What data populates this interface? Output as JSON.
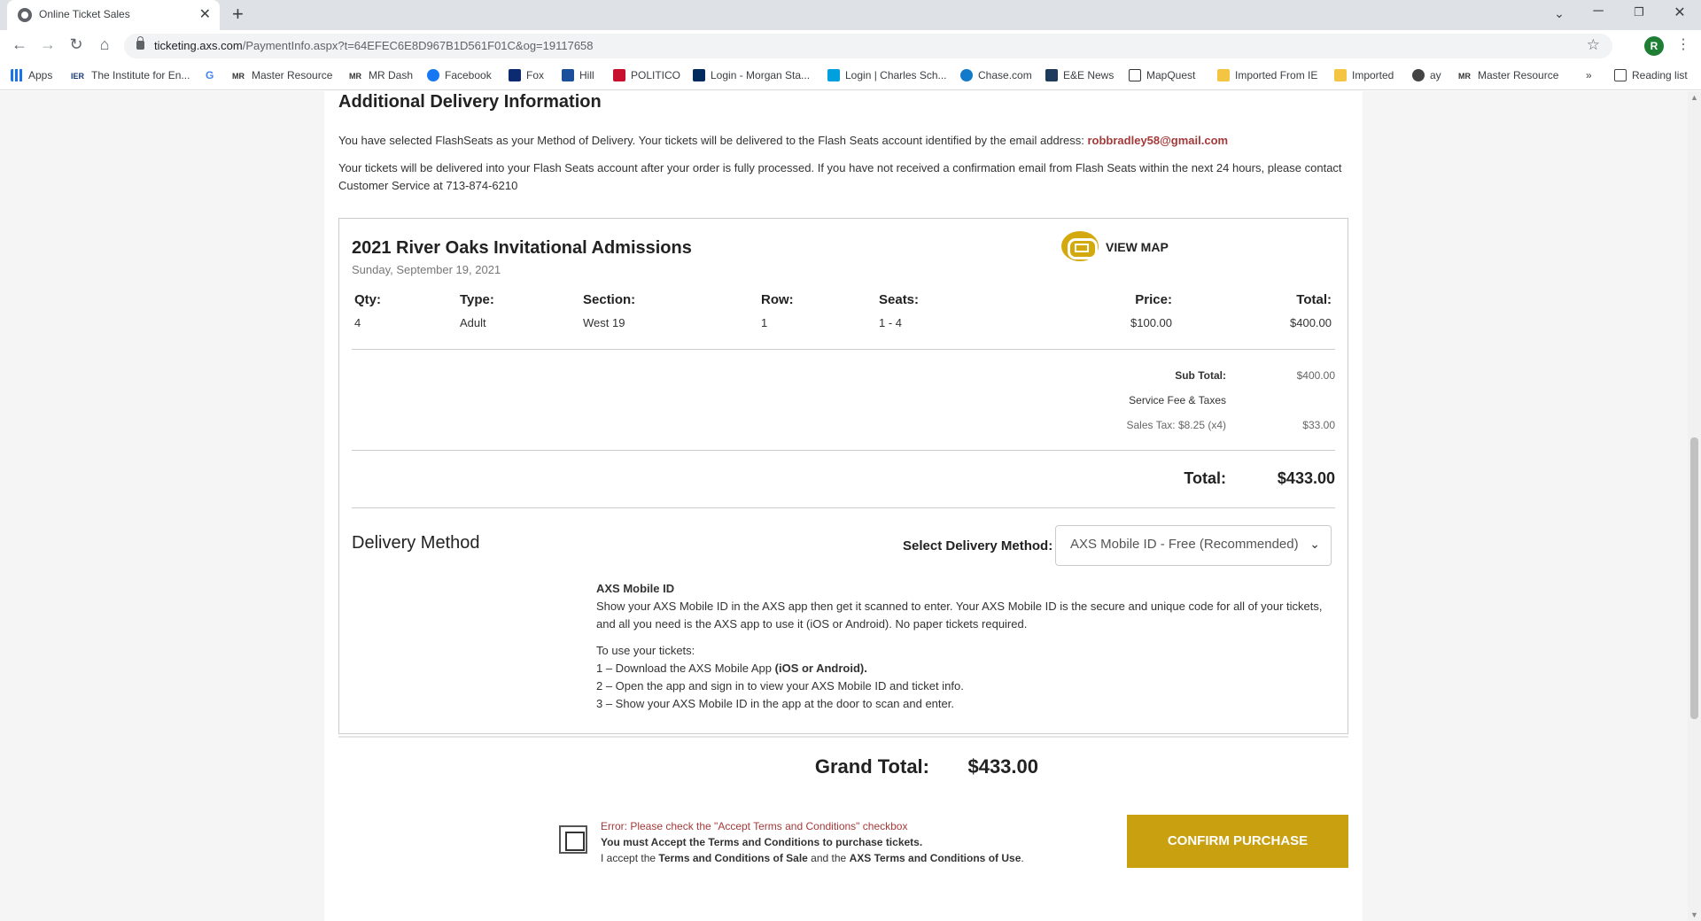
{
  "browser": {
    "tab_title": "Online Ticket Sales",
    "url_host": "ticketing.axs.com",
    "url_path": "/PaymentInfo.aspx?t=64EFEC6E8D967B1D561F01C&og=19117658",
    "profile_initial": "R",
    "bookmarks": [
      {
        "label": "Apps",
        "icon": "apps-grid-icon"
      },
      {
        "label": "The Institute for En...",
        "icon": "ier-icon",
        "icon_text": "IER"
      },
      {
        "label": "",
        "icon": "google-icon",
        "icon_text": "G"
      },
      {
        "label": "Master Resource",
        "icon": "mr-icon",
        "icon_text": "MR"
      },
      {
        "label": "MR Dash",
        "icon": "mr-icon",
        "icon_text": "MR"
      },
      {
        "label": "Facebook",
        "icon": "facebook-icon"
      },
      {
        "label": "Fox",
        "icon": "fox-icon"
      },
      {
        "label": "Hill",
        "icon": "hill-icon"
      },
      {
        "label": "POLITICO",
        "icon": "politico-icon"
      },
      {
        "label": "Login - Morgan Sta...",
        "icon": "morgan-stanley-icon"
      },
      {
        "label": "Login | Charles Sch...",
        "icon": "schwab-icon"
      },
      {
        "label": "Chase.com",
        "icon": "chase-icon"
      },
      {
        "label": "E&E News",
        "icon": "ee-news-icon"
      },
      {
        "label": "MapQuest",
        "icon": "mapquest-icon"
      },
      {
        "label": "Imported From IE",
        "icon": "folder-icon"
      },
      {
        "label": "Imported",
        "icon": "folder-icon"
      },
      {
        "label": "ay",
        "icon": "globe-icon"
      },
      {
        "label": "Master Resource",
        "icon": "mr-icon",
        "icon_text": "MR"
      }
    ],
    "overflow_label": "»",
    "reading_list": "Reading list"
  },
  "delivery_info": {
    "heading": "Additional Delivery Information",
    "line1_prefix": "You have selected FlashSeats as your Method of Delivery. Your tickets will be delivered to the Flash Seats account identified by the email address:",
    "email": "robbradley58@gmail.com",
    "line2": "Your tickets will be delivered into your Flash Seats account after your order is fully processed. If you have not received a confirmation email from Flash Seats within the next 24 hours, please contact Customer Service at 713-874-6210"
  },
  "event": {
    "title": "2021 River Oaks Invitational Admissions",
    "date": "Sunday, September 19, 2021",
    "view_map": "VIEW MAP"
  },
  "ticket_table": {
    "headers": {
      "qty": "Qty:",
      "type": "Type:",
      "section": "Section:",
      "row": "Row:",
      "seats": "Seats:",
      "price": "Price:",
      "total": "Total:"
    },
    "rows": [
      {
        "qty": "4",
        "type": "Adult",
        "section": "West 19",
        "row": "1",
        "seats": "1 - 4",
        "price": "$100.00",
        "total": "$400.00"
      }
    ]
  },
  "summary": {
    "subtotal_label": "Sub Total:",
    "subtotal_value": "$400.00",
    "fees_label": "Service Fee & Taxes",
    "sales_tax_label": "Sales Tax: $8.25 (x4)",
    "sales_tax_value": "$33.00",
    "total_label": "Total:",
    "total_value": "$433.00"
  },
  "delivery_method": {
    "title": "Delivery Method",
    "select_label": "Select Delivery Method:",
    "selected_option": "AXS Mobile ID - Free (Recommended)",
    "info_title": "AXS Mobile ID",
    "info_body": "Show your AXS Mobile ID in the AXS app then get it scanned to enter. Your AXS Mobile ID is the secure and unique code for all of your tickets, and all you need is the AXS app to use it (iOS or Android). No paper tickets required.",
    "use_heading": "To use your tickets:",
    "step1_prefix": "1 – Download the AXS Mobile App ",
    "step1_bold": "(iOS  or Android).",
    "step2": "2 – Open the app and sign in to view your AXS Mobile ID and ticket info.",
    "step3": "3 – Show your AXS Mobile ID in the app at the door to scan and enter."
  },
  "grand_total": {
    "label": "Grand Total:",
    "value": "$433.00"
  },
  "terms": {
    "error": "Error: Please check the \"Accept Terms and Conditions\" checkbox",
    "must_accept": "You must Accept the Terms and Conditions to purchase tickets.",
    "accept_prefix": "I accept the ",
    "sale_terms_link": "Terms and Conditions of Sale",
    "accept_mid": " and the ",
    "axs_terms_link": "AXS Terms and Conditions of Use",
    "accept_suffix": "."
  },
  "confirm_button": "CONFIRM PURCHASE",
  "colors": {
    "accent_gold": "#c9a110",
    "error_red": "#a33a3a",
    "email_red": "#a33a3a"
  }
}
